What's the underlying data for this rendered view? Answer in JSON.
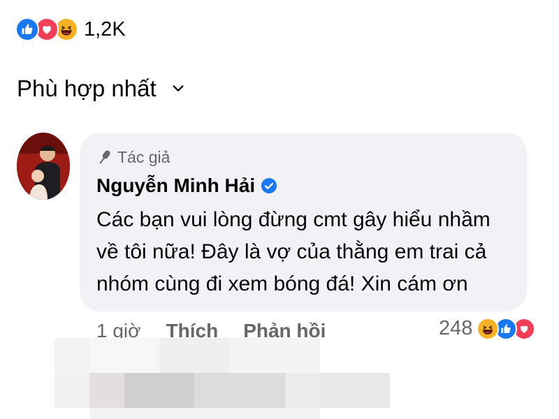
{
  "top_reactions": {
    "icons": [
      "like-icon",
      "love-icon",
      "haha-icon"
    ],
    "count": "1,2K"
  },
  "sort": {
    "label": "Phù hợp nhất",
    "icon": "chevron-down-icon"
  },
  "comment": {
    "badge_icon": "microphone-icon",
    "badge_label": "Tác giả",
    "author": "Nguyễn Minh Hải",
    "verified_icon": "verified-badge-icon",
    "text": "Các bạn vui lòng đừng cmt gây hiểu nhầm về tôi nữa! Đây là vợ của thằng em trai cả nhóm cùng đi xem bóng đá! Xin cám ơn",
    "time": "1 giờ",
    "like_label": "Thích",
    "reply_label": "Phản hồi",
    "reaction_count": "248",
    "reaction_icons": [
      "haha-icon",
      "like-icon",
      "love-icon"
    ]
  },
  "colors": {
    "like": "#1877f2",
    "love": "#f33e58",
    "haha": "#f7b125",
    "bubble": "#f0f2f5",
    "verified": "#1877f2",
    "muted_text": "#65676b"
  }
}
